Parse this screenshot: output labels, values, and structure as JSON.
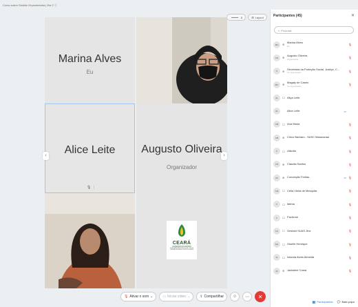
{
  "window": {
    "title": "Curso sobre Gestão Orçamentária | Dia 2 ⓘ"
  },
  "stage_controls": {
    "zoom_value": "8",
    "layout_label": "Layout"
  },
  "tiles": {
    "marina": {
      "name": "Marina Alves",
      "subtitle": "Eu"
    },
    "alice": {
      "name": "Alice Leite",
      "mic_label": "🎙 ⋮"
    },
    "augusto": {
      "name": "Augusto Oliveira",
      "subtitle": "Organizador"
    },
    "logo": {
      "line1": "CEARÁ",
      "line2": "GOVERNO DO ESTADO",
      "line3": "SECRETARIA DA PROTEÇÃO SOCIAL, JUSTIÇA, CIDADANIA, MULHERES E DIREITOS HUMANOS"
    }
  },
  "toolbar": {
    "speak_label": "Ativar o som",
    "video_label": "Iniciar vídeo",
    "share_label": "Compartilhar",
    "more_label": "⋯"
  },
  "participants_panel": {
    "title": "Participantes (45)",
    "search_placeholder": "Procurar",
    "participants": [
      {
        "initials": "MA",
        "icon": "⊕",
        "name": "Marina Alves",
        "role": "Eu",
        "mic": "red"
      },
      {
        "initials": "AO",
        "icon": "⊕",
        "name": "Augusto Oliveira",
        "role": "Organizador",
        "mic": "red"
      },
      {
        "initials": "S",
        "icon": "⊕",
        "name": "Secretaria da Proteção Social, Justiça, C...",
        "role": "Co-organizador",
        "mic": "red"
      },
      {
        "initials": "MC",
        "icon": "⊕",
        "name": "Magaly de Castro",
        "role": "Co-organizador",
        "mic": "red"
      },
      {
        "initials": "AL",
        "icon": "☐",
        "name": "Aliça Leite",
        "role": "",
        "mic": "none"
      },
      {
        "initials": "AL",
        "icon": "",
        "name": "Alice Leite",
        "role": "",
        "mic": "blue"
      },
      {
        "initials": "AM",
        "icon": "☐",
        "name": "Ana Maria",
        "role": "",
        "mic": "red"
      },
      {
        "initials": "CB",
        "icon": "⊕",
        "name": "Chico Barbaro - SASC Maracanaú",
        "role": "",
        "mic": "red"
      },
      {
        "initials": "C",
        "icon": "☐",
        "name": "cláudia",
        "role": "",
        "mic": "red"
      },
      {
        "initials": "CS",
        "icon": "⊕",
        "name": "Claudia Santos",
        "role": "",
        "mic": "red"
      },
      {
        "initials": "CF",
        "icon": "⊕",
        "name": "Conceição Freitas",
        "role": "",
        "mic": "both"
      },
      {
        "initials": "CM",
        "icon": "☐",
        "name": "Célia Vieira de Mesquita",
        "role": "",
        "mic": "red"
      },
      {
        "initials": "F",
        "icon": "☐",
        "name": "fatima",
        "role": "",
        "mic": "red"
      },
      {
        "initials": "F",
        "icon": "☐",
        "name": "FavAnne",
        "role": "",
        "mic": "red"
      },
      {
        "initials": "GJ",
        "icon": "☐",
        "name": "Gestant SUAS Jbvr",
        "role": "",
        "mic": "red"
      },
      {
        "initials": "GH",
        "icon": "☐",
        "name": "Giselle Henrique",
        "role": "",
        "mic": "red"
      },
      {
        "initials": "IA",
        "icon": "☐",
        "name": "Iolanda Alves Almeida",
        "role": "",
        "mic": "red"
      },
      {
        "initials": "JC",
        "icon": "⊕",
        "name": "Jacksline Costa",
        "role": "",
        "mic": "red"
      }
    ],
    "footer": {
      "participants_label": "Participantes",
      "chat_label": "Bate-papo"
    }
  }
}
